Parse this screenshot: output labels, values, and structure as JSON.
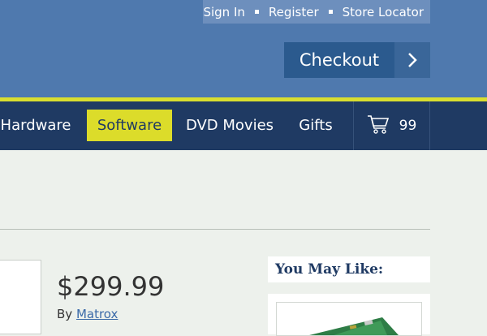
{
  "header": {
    "util_links": [
      "Sign In",
      "Register",
      "Store Locator"
    ],
    "checkout_label": "Checkout"
  },
  "nav": {
    "items": [
      "Hardware",
      "Software",
      "DVD Movies",
      "Gifts"
    ],
    "active": "Software",
    "cart_count": "99"
  },
  "product": {
    "price": "$299.99",
    "by_label": "By",
    "brand": "Matrox"
  },
  "sidebar": {
    "you_may_like_title": "You May Like:"
  },
  "colors": {
    "header_blue": "#4f79ae",
    "nav_navy": "#1f3a63",
    "accent_yellow": "#dcdc2a"
  },
  "icons": [
    "chevron-right-icon",
    "cart-icon"
  ]
}
